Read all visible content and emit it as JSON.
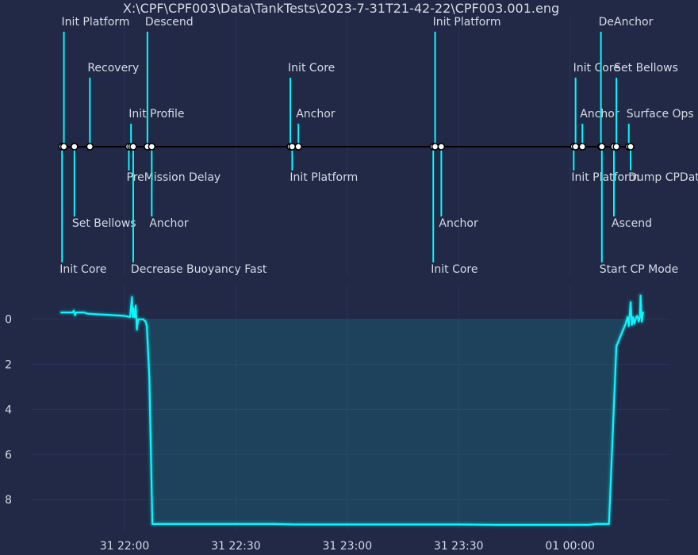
{
  "chart_data": [
    {
      "type": "timeline",
      "title": "X:\\CPF\\CPF003\\Data\\TankTests\\2023-7-31T21-42-22\\CPF003.001.eng",
      "events": [
        {
          "t": "21:43:10",
          "label": "Init Core"
        },
        {
          "t": "21:43:40",
          "label": "Init Platform"
        },
        {
          "t": "21:46:30",
          "label": "Set Bellows"
        },
        {
          "t": "21:50:40",
          "label": "Recovery"
        },
        {
          "t": "22:01:10",
          "label": "PreMission Delay"
        },
        {
          "t": "22:01:45",
          "label": "Init Profile"
        },
        {
          "t": "22:02:20",
          "label": "Decrease Buoyancy Fast"
        },
        {
          "t": "22:06:10",
          "label": "Descend"
        },
        {
          "t": "22:07:20",
          "label": "Anchor"
        },
        {
          "t": "22:44:40",
          "label": "Init Core"
        },
        {
          "t": "22:45:10",
          "label": "Init Platform"
        },
        {
          "t": "22:46:50",
          "label": "Anchor"
        },
        {
          "t": "23:23:10",
          "label": "Init Core"
        },
        {
          "t": "23:23:40",
          "label": "Init Platform"
        },
        {
          "t": "23:25:20",
          "label": "Anchor"
        },
        {
          "t": "00:01:00",
          "label": "Init Platform"
        },
        {
          "t": "00:01:30",
          "label": "Init Core"
        },
        {
          "t": "00:03:20",
          "label": "Anchor"
        },
        {
          "t": "00:08:20",
          "label": "DeAnchor"
        },
        {
          "t": "00:08:35",
          "label": "Start CP Mode"
        },
        {
          "t": "00:11:50",
          "label": "Ascend"
        },
        {
          "t": "00:12:30",
          "label": "Set Bellows"
        },
        {
          "t": "00:15:50",
          "label": "Surface Ops"
        },
        {
          "t": "00:16:20",
          "label": "Dump CPData"
        }
      ]
    },
    {
      "type": "line",
      "x_ticks": [
        "31 22:00",
        "31 22:30",
        "31 23:00",
        "31 23:30",
        "01 00:00"
      ],
      "y_ticks": [
        "0",
        "2",
        "4",
        "6",
        "8"
      ],
      "yinverted": true,
      "xlim": [
        "21:35:00",
        "00:27:00"
      ],
      "ylim": [
        -1.5,
        9.4
      ],
      "grid": true,
      "color": "#08F7FE",
      "series": [
        {
          "x": [
            "21:43:00",
            "21:46:00",
            "21:46:20",
            "21:46:40",
            "21:47:00",
            "21:49:00",
            "21:49:30",
            "21:50:00",
            "21:55:00",
            "22:00:00",
            "22:01:30",
            "22:02:00",
            "22:02:10",
            "22:02:20",
            "22:02:40",
            "22:03:00",
            "22:03:10",
            "22:03:20",
            "22:03:40",
            "22:04:00",
            "22:05:00",
            "22:05:40",
            "22:06:00",
            "22:06:40",
            "22:07:30",
            "22:08:30",
            "22:20:00",
            "22:40:00",
            "22:46:00",
            "23:00:00",
            "23:30:00",
            "23:40:00",
            "00:00:00",
            "00:05:00",
            "00:07:00",
            "00:09:30",
            "00:10:30",
            "00:12:30",
            "00:15:00",
            "00:15:10",
            "00:15:30",
            "00:15:50",
            "00:16:20",
            "00:16:40",
            "00:17:00",
            "00:17:20",
            "00:17:50",
            "00:18:10",
            "00:18:30",
            "00:18:50",
            "00:19:00",
            "00:19:20",
            "00:19:40"
          ],
          "y": [
            -0.3,
            -0.3,
            -0.38,
            -0.18,
            -0.3,
            -0.3,
            -0.28,
            -0.25,
            -0.2,
            -0.15,
            -0.1,
            -0.98,
            -0.1,
            -0.5,
            -0.08,
            -0.6,
            -0.1,
            0.45,
            0,
            0,
            0,
            0.1,
            0.3,
            2.5,
            9.08,
            9.08,
            9.08,
            9.08,
            9.1,
            9.1,
            9.1,
            9.12,
            9.12,
            9.12,
            9.08,
            9.08,
            9.08,
            1.2,
            0.2,
            0.1,
            -0.1,
            0.3,
            -0.75,
            0.25,
            -0.1,
            0.2,
            -0.1,
            -0.15,
            0.1,
            -0.1,
            -1.05,
            0.1,
            -0.3
          ]
        }
      ]
    }
  ]
}
